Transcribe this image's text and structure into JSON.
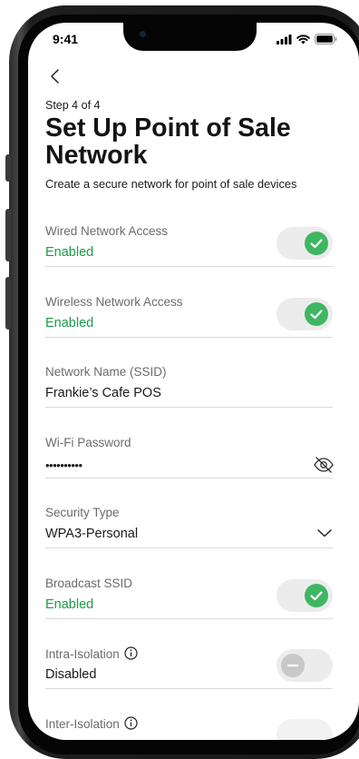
{
  "status_bar": {
    "time": "9:41"
  },
  "header": {
    "step": "Step 4 of 4",
    "title": "Set Up Point of Sale Network",
    "subtitle": "Create a secure network for point of sale devices"
  },
  "fields": {
    "wired": {
      "label": "Wired Network Access",
      "value": "Enabled"
    },
    "wireless": {
      "label": "Wireless Network Access",
      "value": "Enabled"
    },
    "ssid": {
      "label": "Network Name (SSID)",
      "value": "Frankie’s Cafe POS"
    },
    "password": {
      "label": "Wi-Fi Password",
      "value": "••••••••••"
    },
    "security": {
      "label": "Security Type",
      "value": "WPA3-Personal"
    },
    "broadcast": {
      "label": "Broadcast SSID",
      "value": "Enabled"
    },
    "intra": {
      "label": "Intra-Isolation",
      "value": "Disabled"
    },
    "inter": {
      "label": "Inter-Isolation"
    }
  },
  "colors": {
    "accent_green": "#3fb662",
    "enabled_text": "#1c9a4a"
  }
}
